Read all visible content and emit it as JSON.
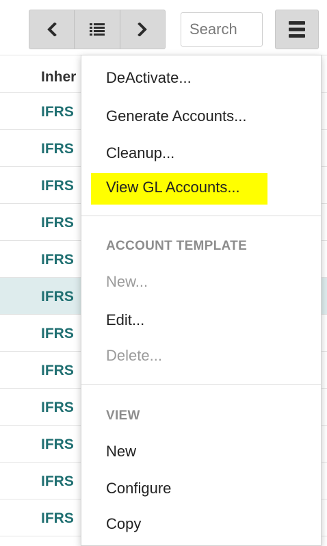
{
  "toolbar": {
    "prev_icon": "chevron-left-icon",
    "list_icon": "list-icon",
    "next_icon": "chevron-right-icon",
    "search_placeholder": "Search",
    "menu_icon": "hamburger-menu-icon"
  },
  "grid": {
    "header": "Inher",
    "rows": [
      "IFRS",
      "IFRS",
      "IFRS",
      "IFRS",
      "IFRS",
      "IFRS",
      "IFRS",
      "IFRS",
      "IFRS",
      "IFRS",
      "IFRS",
      "IFRS"
    ],
    "selected_row_index": 5
  },
  "menu": {
    "deactivate": "DeActivate...",
    "generate_accounts": "Generate Accounts...",
    "cleanup": "Cleanup...",
    "view_gl_accounts": "View GL Accounts...",
    "account_template_header": "ACCOUNT TEMPLATE",
    "new_template": "New...",
    "edit": "Edit...",
    "delete": "Delete...",
    "view_header": "VIEW",
    "view_new": "New",
    "configure": "Configure",
    "copy": "Copy"
  },
  "colors": {
    "link_teal": "#1f6f71",
    "highlight_yellow": "#ffff00",
    "selected_row": "#deeced",
    "button_gray": "#d9d9d9"
  }
}
